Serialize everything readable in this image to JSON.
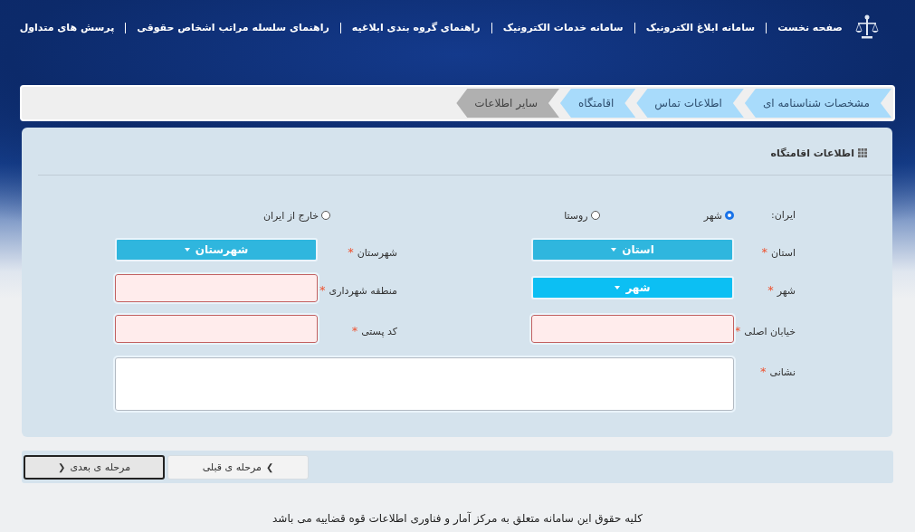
{
  "nav": {
    "items": [
      "صفحه نخست",
      "سامانه ابلاغ الکترونیک",
      "سامانه خدمات الکترونیک",
      "راهنمای گروه بندی ابلاغیه",
      "راهنمای سلسله مراتب اشخاص حقوقی",
      "پرسش های متداول"
    ]
  },
  "steps": [
    {
      "label": "مشخصات شناسنامه ای",
      "enabled": true
    },
    {
      "label": "اطلاعات تماس",
      "enabled": true
    },
    {
      "label": "اقامتگاه",
      "enabled": true
    },
    {
      "label": "سایر اطلاعات",
      "enabled": false
    }
  ],
  "panel": {
    "title": "اطلاعات اقامتگاه",
    "location": {
      "label": "ایران:",
      "options": [
        {
          "label": "شهر",
          "selected": true
        },
        {
          "label": "روستا",
          "selected": false
        },
        {
          "label": "خارج از ایران",
          "selected": false
        }
      ]
    },
    "fields": [
      {
        "kind": "select",
        "label": "استان",
        "required_mark": "*",
        "value": "استان",
        "focused": false
      },
      {
        "kind": "select",
        "label": "شهرستان",
        "required_mark": "*",
        "value": "شهرستان",
        "focused": false
      },
      {
        "kind": "select",
        "label": "شهر",
        "required_mark": "*",
        "value": "شهر",
        "focused": true
      },
      {
        "kind": "text",
        "label": "منطقه شهرداری",
        "required_mark": "*",
        "invalid": true
      },
      {
        "kind": "text",
        "label": "خیابان اصلی",
        "required_mark": "*",
        "invalid": true
      },
      {
        "kind": "text",
        "label": "کد پستی",
        "required_mark": "*",
        "invalid": true
      },
      {
        "kind": "textarea",
        "label": "نشانی",
        "required_mark": "*",
        "invalid": false
      }
    ]
  },
  "buttons": [
    {
      "label": "مرحله ی قبلی",
      "kind": "prev",
      "icon": "❯",
      "focused": false
    },
    {
      "label": "مرحله ی بعدی",
      "kind": "next",
      "icon": "❮",
      "focused": true
    }
  ],
  "footer": "کلیه حقوق این سامانه متعلق به مرکز آمار و فناوری اطلاعات قوه قضاییه می باشد"
}
